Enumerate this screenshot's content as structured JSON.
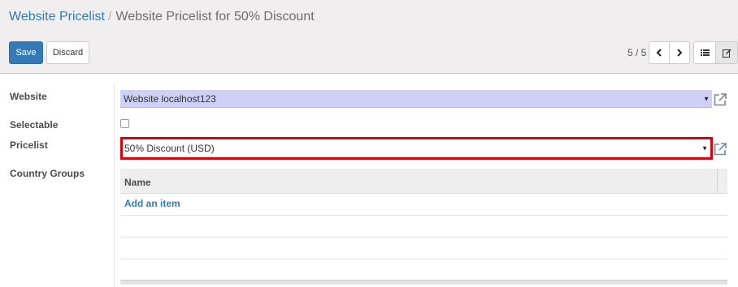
{
  "breadcrumb": {
    "parent": "Website Pricelist",
    "separator": "/",
    "current": "Website Pricelist for 50% Discount"
  },
  "buttons": {
    "save": "Save",
    "discard": "Discard"
  },
  "pager": {
    "value": "5 / 5"
  },
  "form": {
    "website_label": "Website",
    "website_value": "Website localhost123",
    "selectable_label": "Selectable",
    "selectable_checked": false,
    "pricelist_label": "Pricelist",
    "pricelist_value": "50% Discount (USD)",
    "country_groups_label": "Country Groups"
  },
  "country_groups_table": {
    "columns": [
      "Name"
    ],
    "add_item_label": "Add an item"
  },
  "colors": {
    "primary": "#337ab7",
    "highlight_border": "#d9000d",
    "required_field": "#cfcff8"
  }
}
